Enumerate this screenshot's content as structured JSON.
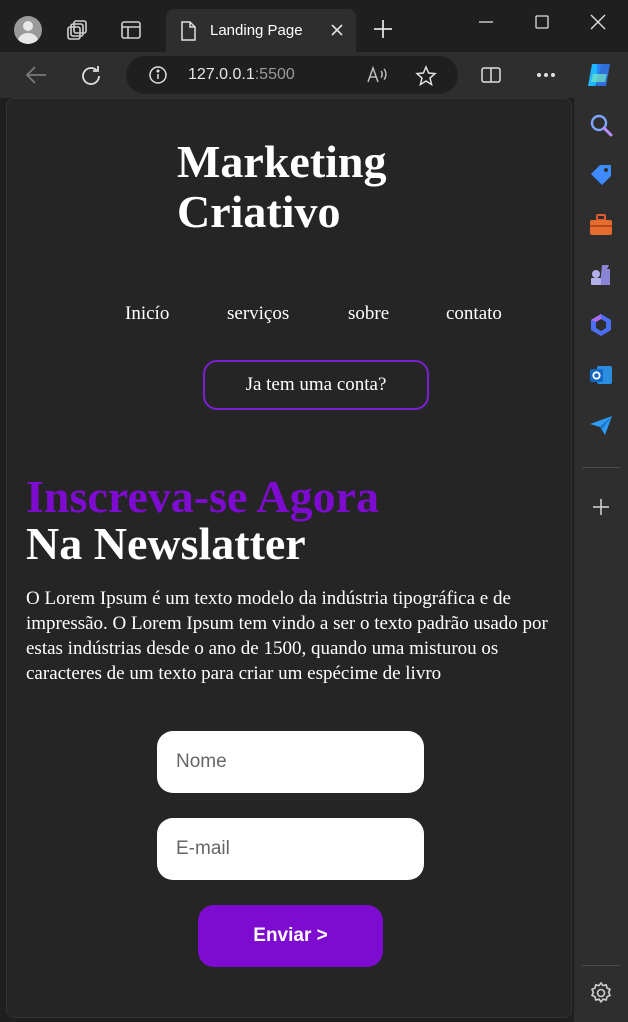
{
  "browser": {
    "tab_title": "Landing Page",
    "url_host": "127.0.0.1",
    "url_port": ":5500"
  },
  "page": {
    "logo_line1": "Marketing",
    "logo_line2": "Criativo",
    "nav": [
      "Inicío",
      "serviços",
      "sobre",
      "contato"
    ],
    "account_button": "Ja tem uma conta?",
    "headline_purple": "Inscreva-se Agora",
    "headline_white": "Na Newslatter",
    "paragraph": "O Lorem Ipsum é um texto modelo da indústria tipográfica e de impressão. O Lorem Ipsum tem vindo a ser o texto padrão usado por estas indústrias desde o ano de 1500, quando uma misturou os caracteres de um texto para criar um espécime de livro",
    "name_placeholder": "Nome",
    "email_placeholder": "E-mail",
    "submit_button": "Enviar >"
  },
  "colors": {
    "accent": "#7e0bd0",
    "page_bg": "#252525",
    "chrome_bg": "#1f1f1f"
  }
}
